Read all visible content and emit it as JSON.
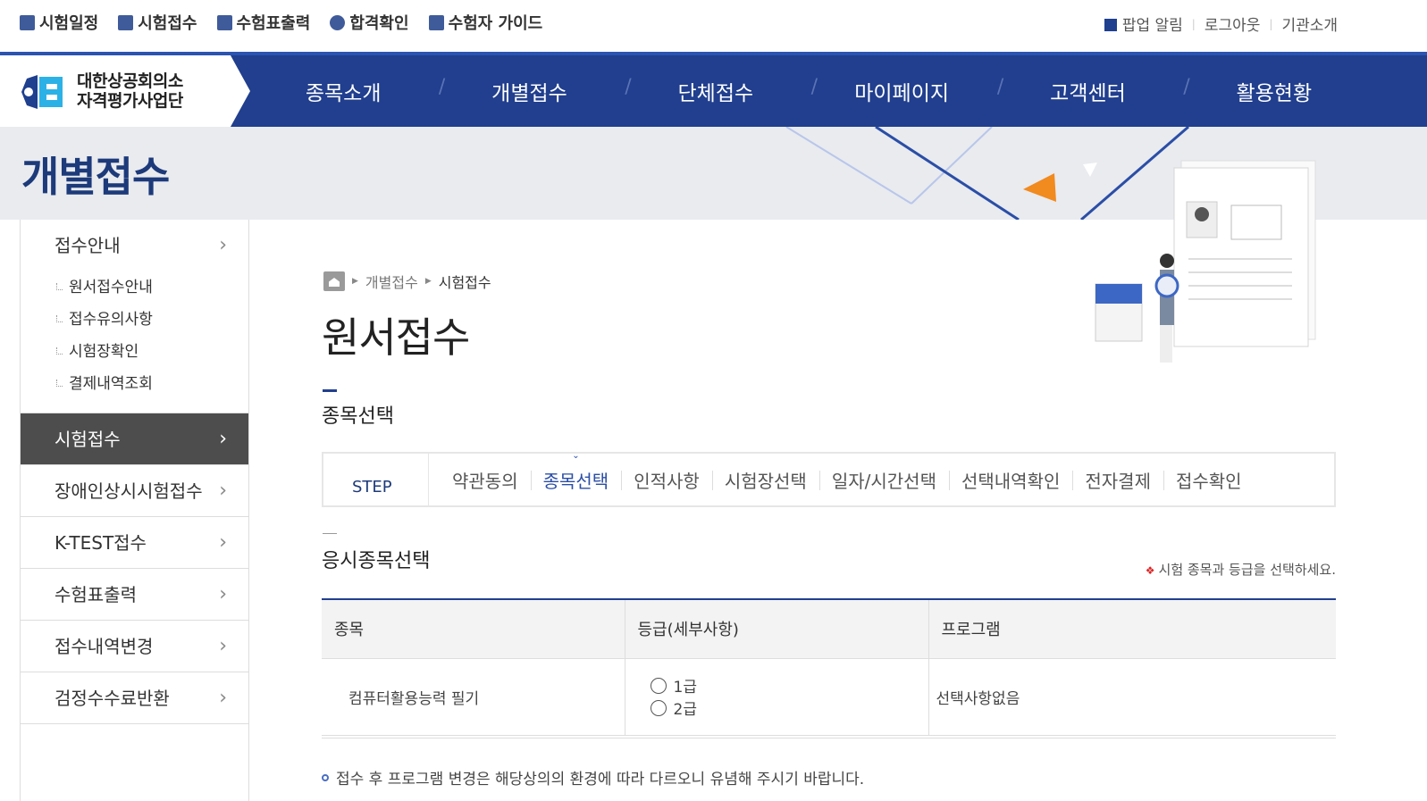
{
  "utility": {
    "left_items": [
      {
        "label": "시험일정",
        "icon": "calendar-icon"
      },
      {
        "label": "시험접수",
        "icon": "edit-icon"
      },
      {
        "label": "수험표출력",
        "icon": "print-icon"
      },
      {
        "label": "합격확인",
        "icon": "badge-icon"
      },
      {
        "label": "수험자 가이드",
        "icon": "book-icon"
      }
    ],
    "popup": "팝업 알림",
    "logout": "로그아웃",
    "about": "기관소개"
  },
  "logo": {
    "line1": "대한상공회의소",
    "line2": "자격평가사업단"
  },
  "gnb": [
    "종목소개",
    "개별접수",
    "단체접수",
    "마이페이지",
    "고객센터",
    "활용현황"
  ],
  "band_title": "개별접수",
  "sidebar": {
    "first": "접수안내",
    "subs": [
      "원서접수안내",
      "접수유의사항",
      "시험장확인",
      "결제내역조회"
    ],
    "items": [
      "시험접수",
      "장애인상시시험접수",
      "K-TEST접수",
      "수험표출력",
      "접수내역변경",
      "검정수수료반환"
    ]
  },
  "breadcrumb": {
    "level1": "개별접수",
    "current": "시험접수"
  },
  "page_title": "원서접수",
  "section_title": "종목선택",
  "steps": {
    "label": "STEP",
    "items": [
      "약관동의",
      "종목선택",
      "인적사항",
      "시험장선택",
      "일자/시간선택",
      "선택내역확인",
      "전자결제",
      "접수확인"
    ],
    "active_index": 1
  },
  "subsection": {
    "title": "응시종목선택",
    "note": "시험 종목과 등급을 선택하세요."
  },
  "table": {
    "headers": [
      "종목",
      "등급(세부사항)",
      "프로그램"
    ],
    "subject": "컴퓨터활용능력 필기",
    "grades": [
      "1급",
      "2급"
    ],
    "program": "선택사항없음"
  },
  "footer_note": "접수 후 프로그램 변경은 해당상의의 환경에 따라 다르오니 유념해 주시기 바랍니다."
}
